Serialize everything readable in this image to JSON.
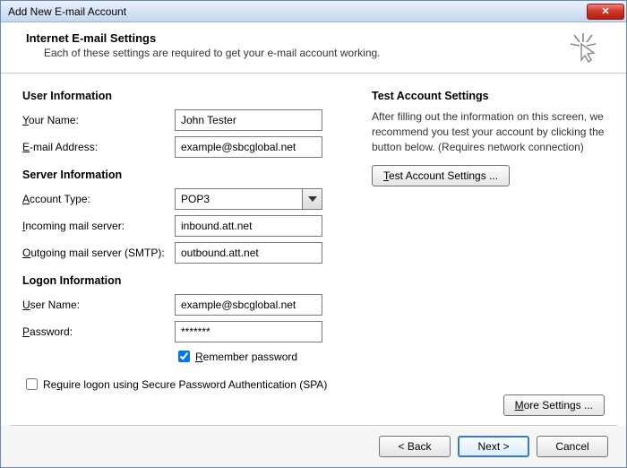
{
  "window": {
    "title": "Add New E-mail Account"
  },
  "header": {
    "title": "Internet E-mail Settings",
    "subtitle": "Each of these settings are required to get your e-mail account working."
  },
  "userInfo": {
    "section_label": "User Information",
    "your_name_label": "Your Name:",
    "your_name_value": "John Tester",
    "email_label": "E-mail Address:",
    "email_value": "example@sbcglobal.net"
  },
  "serverInfo": {
    "section_label": "Server Information",
    "account_type_label": "Account Type:",
    "account_type_value": "POP3",
    "incoming_label": "Incoming mail server:",
    "incoming_value": "inbound.att.net",
    "outgoing_label": "Outgoing mail server (SMTP):",
    "outgoing_value": "outbound.att.net"
  },
  "logonInfo": {
    "section_label": "Logon Information",
    "username_label": "User Name:",
    "username_value": "example@sbcglobal.net",
    "password_label": "Password:",
    "password_value": "*******",
    "remember_label": "Remember password",
    "spa_label": "Require logon using Secure Password Authentication (SPA)"
  },
  "testSettings": {
    "section_label": "Test Account Settings",
    "description": "After filling out the information on this screen, we recommend you test your account by clicking the button below. (Requires network connection)",
    "button_label": "Test Account Settings ..."
  },
  "buttons": {
    "more_settings": "More Settings ...",
    "back": "< Back",
    "next": "Next >",
    "cancel": "Cancel"
  }
}
